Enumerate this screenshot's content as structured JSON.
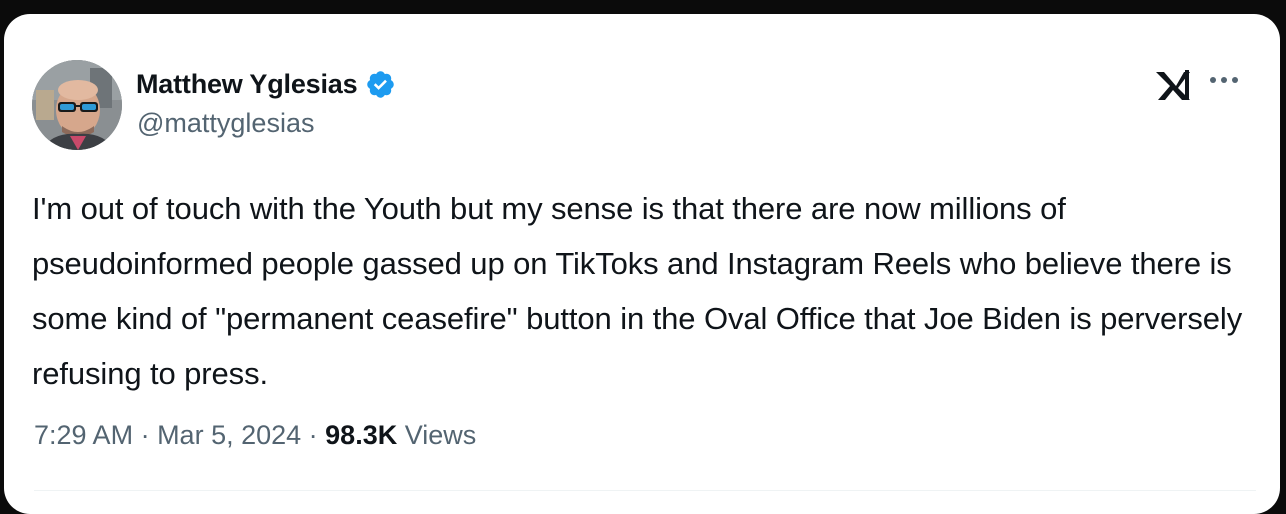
{
  "author": {
    "display_name": "Matthew Yglesias",
    "handle": "@mattyglesias",
    "verified": true
  },
  "icons": {
    "verified": "verified-badge-icon",
    "logo": "x-logo-icon",
    "more": "more-options-icon"
  },
  "tweet": {
    "text": "I'm out of touch with the Youth but my sense is that there are now millions of pseudoinformed people gassed up on TikToks and Instagram Reels who believe there is some kind of \"permanent ceasefire\" button in the Oval Office that Joe Biden is perversely refusing to press."
  },
  "meta": {
    "time": "7:29 AM",
    "separator": " · ",
    "date": "Mar 5, 2024",
    "views_count": "98.3K",
    "views_label": " Views"
  },
  "colors": {
    "verified_blue": "#1d9bf0",
    "text_primary": "#0f1419",
    "text_secondary": "#536471"
  }
}
